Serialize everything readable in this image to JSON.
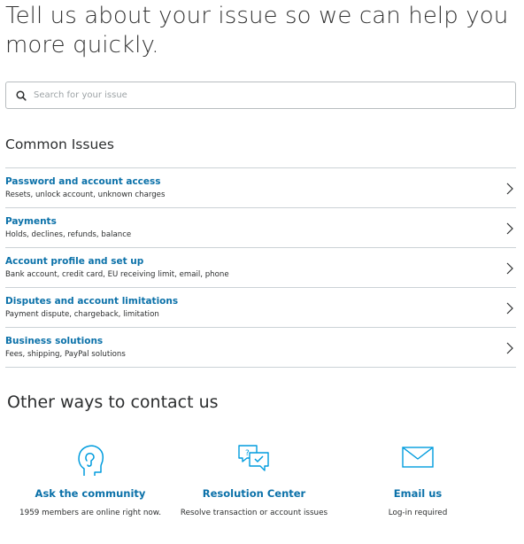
{
  "header": {
    "headline": "Tell us about your issue so we can help you more quickly."
  },
  "search": {
    "placeholder": "Search for your issue",
    "value": ""
  },
  "common_issues": {
    "title": "Common Issues",
    "items": [
      {
        "title": "Password and account access",
        "description": "Resets, unlock account, unknown charges"
      },
      {
        "title": "Payments",
        "description": "Holds, declines, refunds, balance"
      },
      {
        "title": "Account profile and set up",
        "description": "Bank account, credit card, EU receiving limit, email, phone"
      },
      {
        "title": "Disputes and account limitations",
        "description": "Payment dispute, chargeback, limitation"
      },
      {
        "title": "Business solutions",
        "description": "Fees, shipping, PayPal solutions"
      }
    ]
  },
  "contact": {
    "title": "Other ways to contact us",
    "options": [
      {
        "title": "Ask the community",
        "subtitle": "1959 members are online right now.",
        "icon": "community-head-icon"
      },
      {
        "title": "Resolution Center",
        "subtitle": "Resolve transaction or account issues",
        "icon": "chat-bubbles-icon"
      },
      {
        "title": "Email us",
        "subtitle": "Log-in required",
        "icon": "envelope-icon"
      }
    ]
  },
  "colors": {
    "link": "#0b71a9",
    "icon": "#009cde",
    "text": "#2c2e2f",
    "divider": "#cbd2d6"
  }
}
